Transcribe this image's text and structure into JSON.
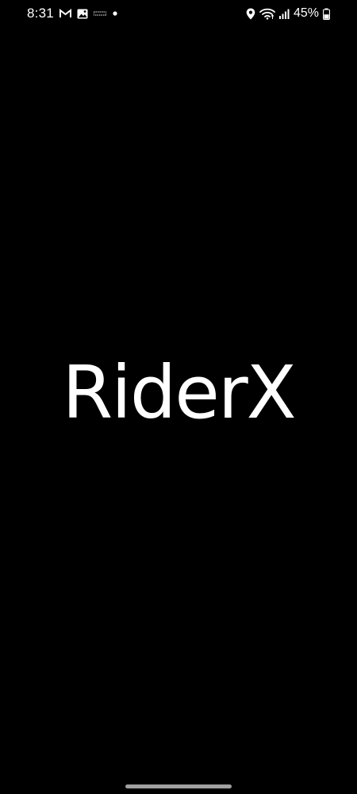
{
  "status_bar": {
    "time": "8:31",
    "battery_percent": "45%",
    "left_icons": [
      "gmail-icon",
      "gallery-icon",
      "more-notifications-icon",
      "notification-dot-icon"
    ],
    "right_icons": [
      "location-icon",
      "wifi-icon",
      "signal-icon",
      "battery-icon"
    ]
  },
  "splash": {
    "logo_text": "RiderX"
  },
  "colors": {
    "background": "#000000",
    "foreground": "#ffffff",
    "home_indicator": "#a0a0a0"
  }
}
